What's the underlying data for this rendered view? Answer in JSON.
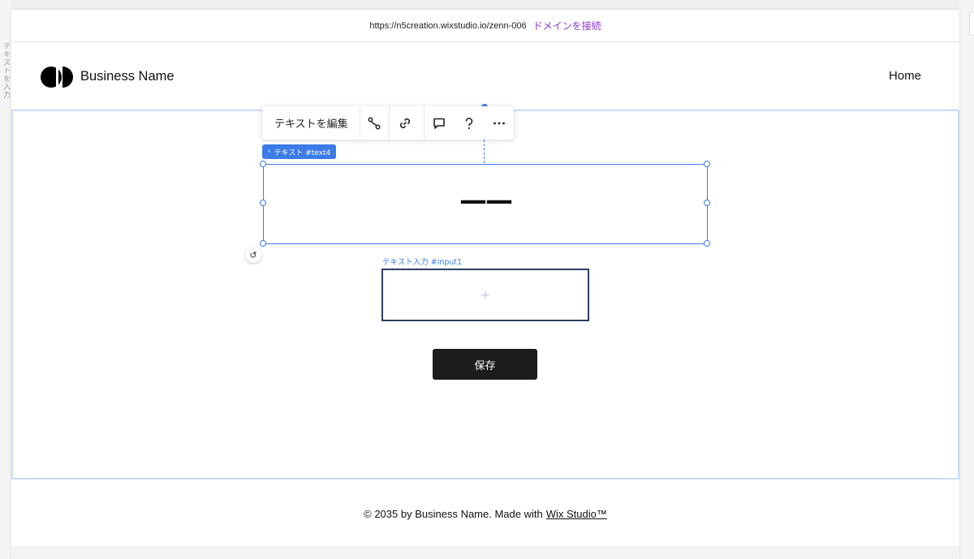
{
  "editor": {
    "side_text": "テキストを入力",
    "url_bar": {
      "url": "https://n5creation.wixstudio.io/zenn-006",
      "connect_label": "ドメインを接続"
    }
  },
  "site": {
    "brand_name": "Business Name",
    "nav": [
      "Home"
    ]
  },
  "toolbar": {
    "edit_text_label": "テキストを編集",
    "icons": [
      "connect-icon",
      "link-icon",
      "comment-icon",
      "help-icon",
      "more-icon"
    ]
  },
  "selection": {
    "element_badge": "テキスト #text4",
    "text_content": "——",
    "input_label": "テキスト入力 #input1"
  },
  "form": {
    "save_label": "保存"
  },
  "footer": {
    "copyright": "© 2035 by Business Name. Made with",
    "link_text": "Wix Studio™"
  },
  "colors": {
    "selection_blue": "#3b7be8",
    "connect_purple": "#8c34d9",
    "section_outline": "#c6dcf7",
    "input_border": "#2b3d63",
    "button_dark": "#1c1c1c"
  }
}
